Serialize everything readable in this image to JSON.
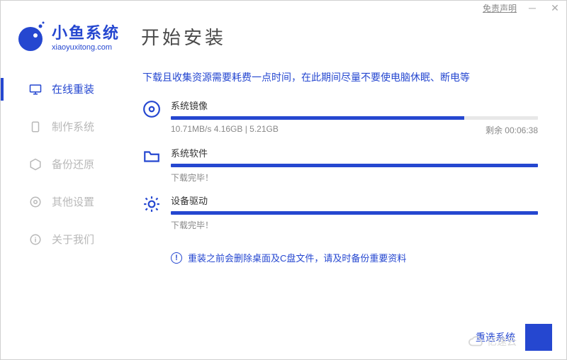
{
  "titlebar": {
    "disclaimer": "免责声明"
  },
  "brand": {
    "name": "小鱼系统",
    "domain": "xiaoyuxitong.com"
  },
  "page_title": "开始安装",
  "sidebar": {
    "items": [
      {
        "label": "在线重装"
      },
      {
        "label": "制作系统"
      },
      {
        "label": "备份还原"
      },
      {
        "label": "其他设置"
      },
      {
        "label": "关于我们"
      }
    ]
  },
  "notice": "下载且收集资源需要耗费一点时间，在此期间尽量不要使电脑休眠、断电等",
  "tasks": [
    {
      "title": "系统镜像",
      "left": "10.71MB/s 4.16GB | 5.21GB",
      "right": "剩余 00:06:38",
      "percent": 80
    },
    {
      "title": "系统软件",
      "left": "下载完毕！",
      "right": "",
      "percent": 100
    },
    {
      "title": "设备驱动",
      "left": "下载完毕！",
      "right": "",
      "percent": 100
    }
  ],
  "warning": "重装之前会删除桌面及C盘文件，请及时备份重要资料",
  "footer": {
    "reselect": "重选系统"
  },
  "watermark": "亿速云",
  "colors": {
    "primary": "#2547d0"
  }
}
